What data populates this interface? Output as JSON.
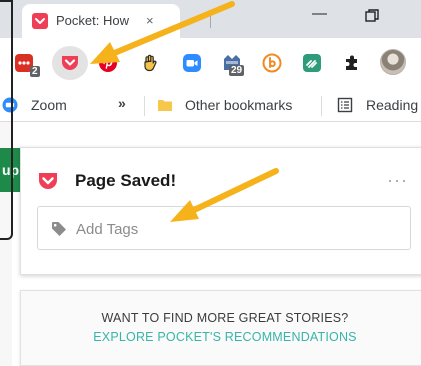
{
  "browser": {
    "tab_title": "Pocket: How",
    "tab_close": "×",
    "minimize_glyph": "—",
    "colors": {
      "chrome": "#dee1e6",
      "tab": "#ffffff"
    }
  },
  "toolbar": {
    "extensions": [
      {
        "name": "red-extension-icon",
        "badge": "2"
      },
      {
        "name": "pocket-extension-icon"
      },
      {
        "name": "pinterest-icon"
      },
      {
        "name": "hand-icon"
      },
      {
        "name": "zoom-icon"
      },
      {
        "name": "calendar-icon",
        "badge": "29"
      },
      {
        "name": "b-extension-icon"
      },
      {
        "name": "green-extension-icon"
      },
      {
        "name": "puzzle-icon"
      },
      {
        "name": "profile-avatar"
      }
    ]
  },
  "bookmarks": {
    "zoom_label": "Zoom",
    "overflow": "»",
    "other_label": "Other bookmarks",
    "reading_label": "Reading"
  },
  "page": {
    "green_strip_text": "up"
  },
  "popup": {
    "title": "Page Saved!",
    "more": "···",
    "tag_placeholder": "Add Tags",
    "reco_heading": "WANT TO FIND MORE GREAT STORIES?",
    "reco_link": "EXPLORE POCKET'S RECOMMENDATIONS",
    "colors": {
      "pocket": "#ef3f56",
      "link": "#37b5a8",
      "arrow": "#f5b21a"
    }
  }
}
